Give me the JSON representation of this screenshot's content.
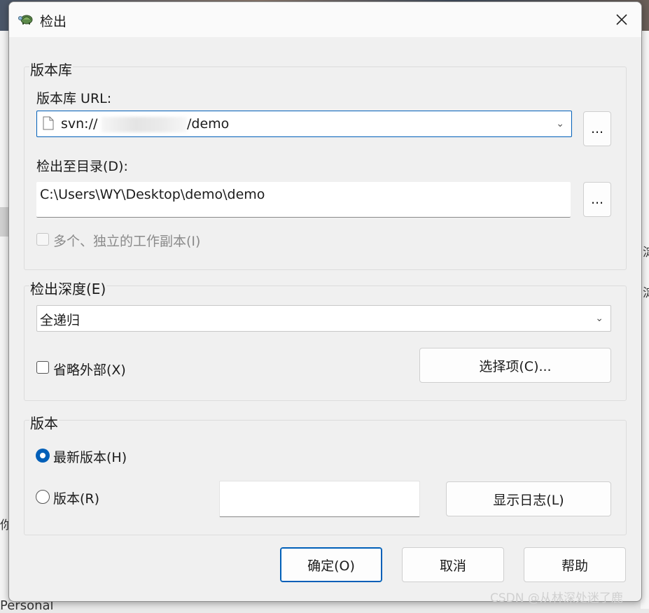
{
  "window": {
    "title": "检出"
  },
  "repository_group": {
    "title": "版本库",
    "url_label": "版本库 URL:",
    "url_prefix": "svn://",
    "url_suffix": "/demo",
    "browse_label": "...",
    "checkout_dir_label": "检出至目录(D):",
    "checkout_dir_value": "C:\\Users\\WY\\Desktop\\demo\\demo",
    "browse_dir_label": "...",
    "multiple_label": "多个、独立的工作副本(I)"
  },
  "depth_group": {
    "title": "检出深度(E)",
    "selected": "全递归",
    "omit_externals_label": "省略外部(X)",
    "choose_items_label": "选择项(C)..."
  },
  "revision_group": {
    "title": "版本",
    "head_label": "最新版本(H)",
    "revision_label": "版本(R)",
    "revision_value": "",
    "show_log_label": "显示日志(L)"
  },
  "footer": {
    "ok_label": "确定(O)",
    "cancel_label": "取消",
    "help_label": "帮助"
  },
  "background": {
    "fragment_bottom": "Personal",
    "fragment_left": "你",
    "fragment_right_1": "淀",
    "fragment_right_2": "淀",
    "watermark": "CSDN @从林深处迷了鹿"
  },
  "colors": {
    "accent": "#005fb8",
    "dialog_bg": "#f0f0f0"
  },
  "icons": {
    "app": "tortoise-icon",
    "close": "close-icon",
    "dropdown": "chevron-down-icon"
  }
}
